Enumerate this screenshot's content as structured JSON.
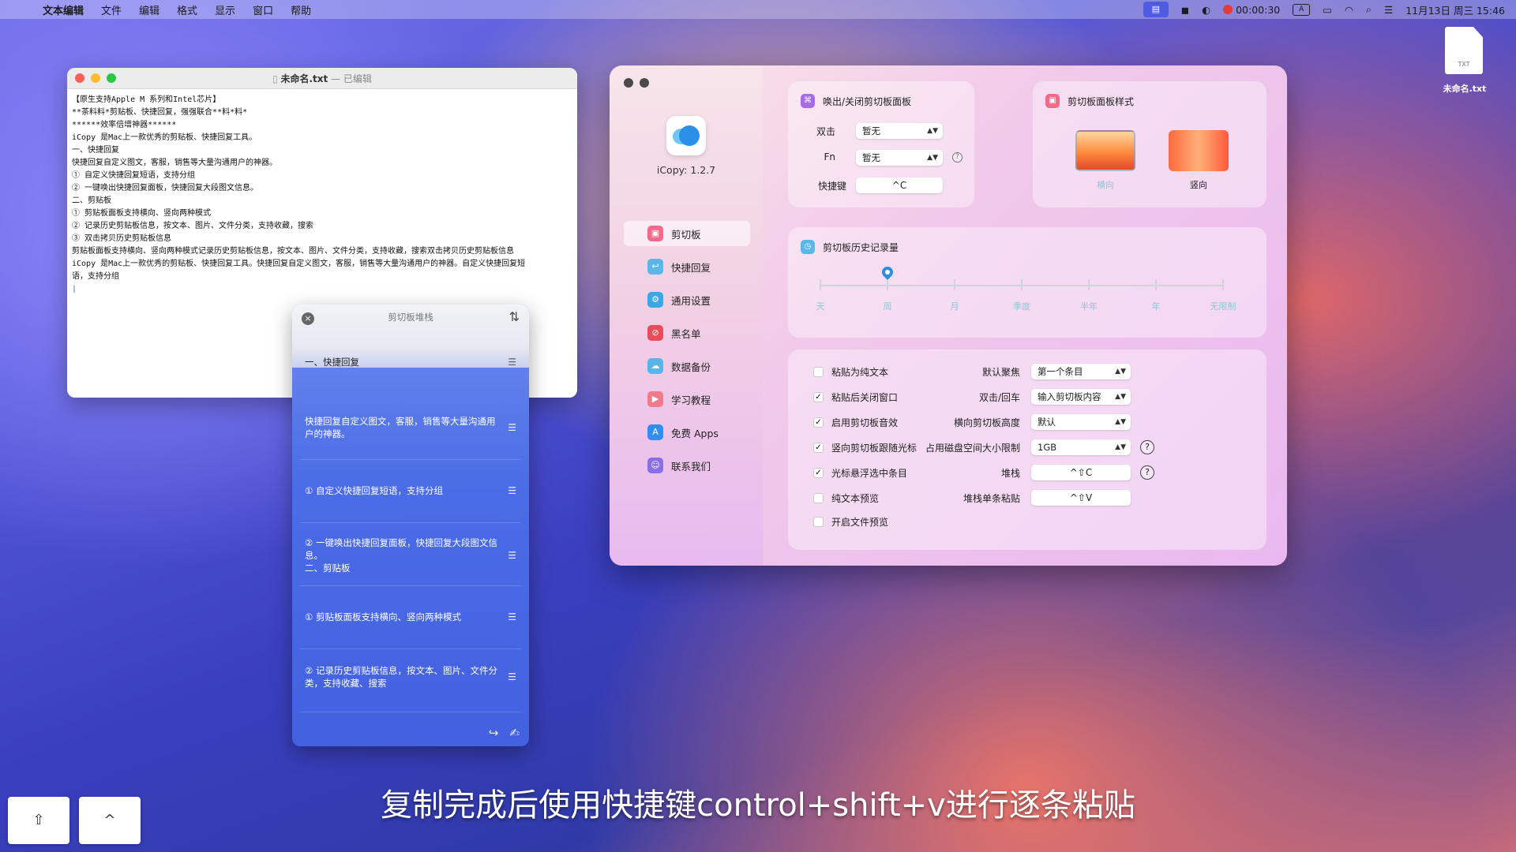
{
  "menubar": {
    "app": "文本编辑",
    "items": [
      "文件",
      "编辑",
      "格式",
      "显示",
      "窗口",
      "帮助"
    ],
    "timer": "00:00:30",
    "input_src": "A",
    "datetime": "11月13日 周三 15:46"
  },
  "editor": {
    "filename": "未命名.txt",
    "status": "— 已编辑",
    "lines": [
      "【原生支持Apple M 系列和Intel芯片】",
      "**茶料料*剪贴板、快捷回复，强强联合**料*料*",
      "******效率倍增神器******",
      "iCopy 是Mac上一款优秀的剪贴板、快捷回复工具。",
      "一、快捷回复",
      "快捷回复自定义图文，客服，销售等大量沟通用户的神器。",
      "① 自定义快捷回复短语，支持分组",
      "② 一键唤出快捷回复面板，快捷回复大段图文信息。",
      "二、剪贴板",
      "① 剪贴板面板支持横向、竖向两种模式",
      "② 记录历史剪贴板信息，按文本、图片、文件分类，支持收藏，搜索",
      "③ 双击拷贝历史剪贴板信息",
      "剪贴板面板支持横向、竖向两种模式记录历史剪贴板信息，按文本、图片、文件分类，支持收藏，搜索双击拷贝历史剪贴板信息",
      "iCopy 是Mac上一款优秀的剪贴板、快捷回复工具。快捷回复自定义图文，客服，销售等大量沟通用户的神器。自定义快捷回复短",
      "语，支持分组"
    ]
  },
  "stack": {
    "title": "剪切板堆栈",
    "items": [
      "一、快捷回复",
      "快捷回复自定义图文，客服，销售等大量沟通用户的神器。",
      "① 自定义快捷回复短语，支持分组",
      "② 一键唤出快捷回复面板，快捷回复大段图文信息。\n二、剪贴板",
      "① 剪贴板面板支持横向、竖向两种模式",
      "② 记录历史剪贴板信息，按文本、图片、文件分类，支持收藏、搜索"
    ]
  },
  "icopy": {
    "version": "iCopy: 1.2.7",
    "nav": [
      "剪切板",
      "快捷回复",
      "通用设置",
      "黑名单",
      "数据备份",
      "学习教程",
      "免费 Apps",
      "联系我们"
    ],
    "toggle_card": {
      "title": "唤出/关闭剪切板面板",
      "double_label": "双击",
      "double_value": "暂无",
      "fn_label": "Fn",
      "fn_value": "暂无",
      "shortcut_label": "快捷键",
      "shortcut_value": "^C"
    },
    "style_card": {
      "title": "剪切板面板样式",
      "horizontal": "横向",
      "vertical": "竖向"
    },
    "history_card": {
      "title": "剪切板历史记录量",
      "ticks": [
        "天",
        "周",
        "月",
        "季度",
        "半年",
        "年",
        "无限制"
      ],
      "selected": "周",
      "selected_index": 1
    },
    "options": {
      "checkboxes": [
        {
          "label": "粘贴为纯文本",
          "checked": false
        },
        {
          "label": "粘贴后关闭窗口",
          "checked": true
        },
        {
          "label": "启用剪切板音效",
          "checked": true
        },
        {
          "label": "竖向剪切板跟随光标",
          "checked": true
        },
        {
          "label": "光标悬浮选中条目",
          "checked": true
        },
        {
          "label": "纯文本预览",
          "checked": false
        },
        {
          "label": "开启文件预览",
          "checked": false
        }
      ],
      "default_focus_label": "默认聚焦",
      "default_focus": "第一个条目",
      "dblclick_label": "双击/回车",
      "dblclick": "输入剪切板内容",
      "height_label": "横向剪切板高度",
      "height": "默认",
      "disk_label": "占用磁盘空间大小限制",
      "disk": "1GB",
      "stack_label": "堆栈",
      "stack_key": "^⇧C",
      "stack_paste_label": "堆栈单条粘贴",
      "stack_paste_key": "^⇧V"
    }
  },
  "desktop": {
    "file_ext": "TXT",
    "file_name": "未命名.txt"
  },
  "subtitle": "复制完成后使用快捷键control+shift+v进行逐条粘贴",
  "keys": [
    "⇧",
    "^"
  ]
}
